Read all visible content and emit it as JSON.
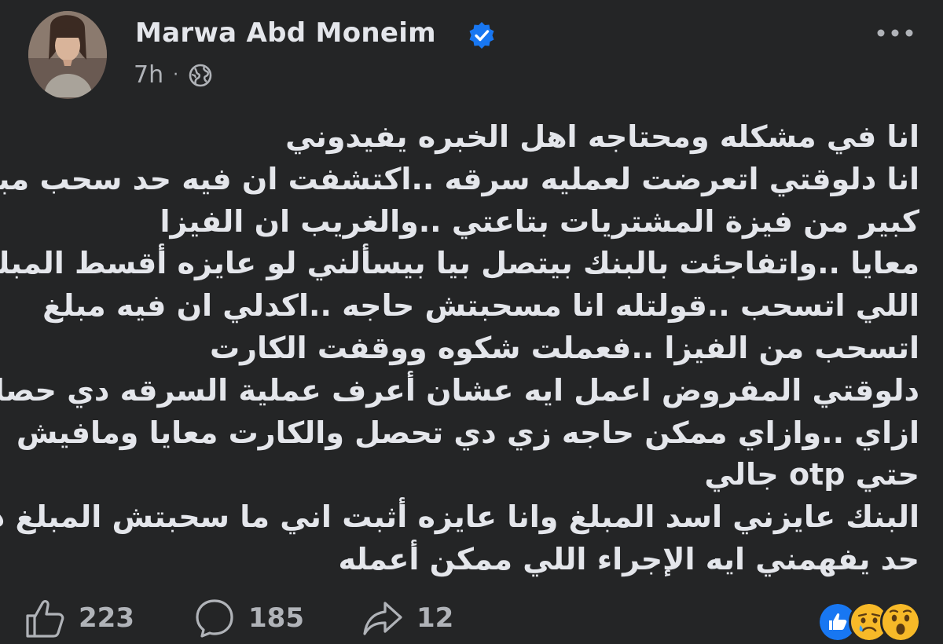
{
  "post": {
    "author": "Marwa Abd Moneim",
    "verified_icon": "verified-badge-icon",
    "time": "7h",
    "separator": "·",
    "audience_icon": "globe-icon",
    "body_lines": [
      "انا في مشكله ومحتاجه اهل الخبره يفيدوني",
      "انا دلوقتي اتعرضت لعمليه سرقه ..اكتشفت ان فيه حد سحب مبلغ",
      "كبير من فيزة المشتريات بتاعتي ..والغريب ان الفيزا",
      "معايا ..واتفاجئت بالبنك بيتصل بيا بيسألني لو عايزه أقسط المبلغ",
      "اللي اتسحب ..قولتله انا مسحبتش حاجه ..اكدلي ان فيه مبلغ",
      "اتسحب من الفيزا ..فعملت شكوه ووقفت الكارت",
      "دلوقتي المفروض اعمل ايه عشان أعرف عملية السرقه دي حصلت",
      "ازاي ..وازاي ممكن حاجه زي دي تحصل والكارت معايا ومافيش",
      "حتي otp جالي",
      "البنك عايزني اسد المبلغ وانا عايزه أثبت اني ما سحبتش المبلغ ده",
      "حد يفهمني ايه الإجراء اللي ممكن أعمله"
    ]
  },
  "footer": {
    "likes": "223",
    "comments": "185",
    "shares": "12",
    "reactions": [
      "like",
      "sad",
      "wow"
    ]
  },
  "colors": {
    "background": "#242526",
    "text_primary": "#e4e6eb",
    "text_secondary": "#b0b3b8",
    "verified_blue": "#1877f2"
  }
}
